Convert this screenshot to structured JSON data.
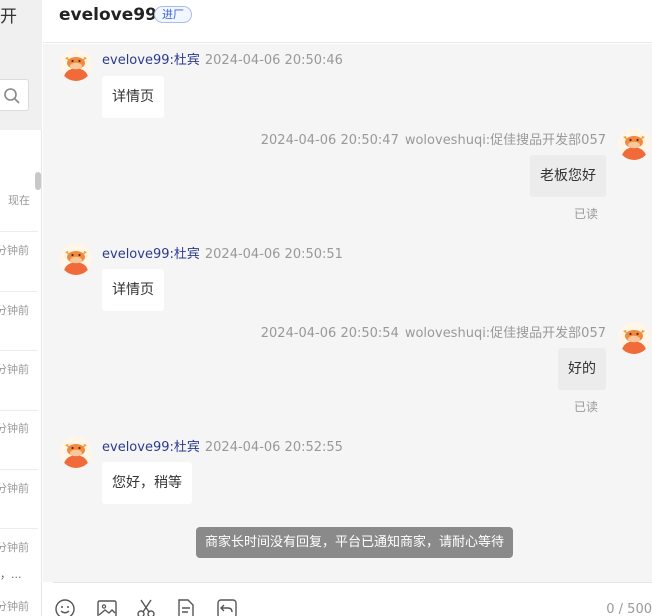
{
  "left_panel": {
    "header_char": "开",
    "times": [
      "现在",
      "分钟前",
      "分钟前",
      "分钟前",
      "分钟前",
      "分钟前",
      "分钟前",
      "分钟前"
    ],
    "ellipsis": "，..."
  },
  "header": {
    "title": "evelove99",
    "tag": "进厂"
  },
  "messages": [
    {
      "side": "left",
      "sender": "evelove99:杜宾",
      "time": "2024-04-06 20:50:46",
      "text": "详情页"
    },
    {
      "side": "right",
      "sender": "woloveshuqi:促佳搜品开发部057",
      "time": "2024-04-06 20:50:47",
      "text": "老板您好",
      "status": "已读"
    },
    {
      "side": "left",
      "sender": "evelove99:杜宾",
      "time": "2024-04-06 20:50:51",
      "text": "详情页"
    },
    {
      "side": "right",
      "sender": "woloveshuqi:促佳搜品开发部057",
      "time": "2024-04-06 20:50:54",
      "text": "好的",
      "status": "已读"
    },
    {
      "side": "left",
      "sender": "evelove99:杜宾",
      "time": "2024-04-06 20:52:55",
      "text": "您好，稍等"
    }
  ],
  "notice": "商家长时间没有回复，平台已通知商家，请耐心等待",
  "toolbar": {
    "tools": [
      "emoji-icon",
      "image-icon",
      "scissors-icon",
      "file-icon",
      "undo-icon"
    ],
    "char_counter": "0 / 500"
  }
}
